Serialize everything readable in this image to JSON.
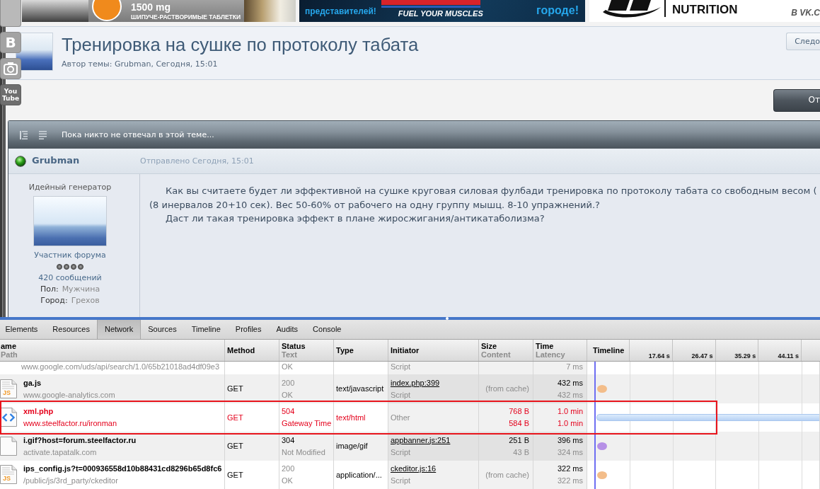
{
  "ad_banners": [
    {
      "kind": "tablets",
      "texts": [
        "1500 mg",
        "ШИПУЧЕ-РАСТВОРИМЫЕ ТАБЛЕТКИ"
      ]
    },
    {
      "kind": "protein",
      "texts": [
        "представителей!",
        "FUEL YOUR MUSCLES",
        "городе!"
      ]
    },
    {
      "kind": "nutrition",
      "texts": [
        "NUTRITION",
        "В VK.C"
      ]
    }
  ],
  "social_links": [
    {
      "kind": "tile"
    },
    {
      "kind": "letter",
      "label": "B"
    },
    {
      "kind": "camera"
    },
    {
      "kind": "wordmark",
      "label": "You Tube"
    }
  ],
  "topic": {
    "title": "Тренировка на сушке по протоколу табата",
    "meta": "Автор темы: Grubman, Сегодня, 15:01",
    "follow_button": "Следо"
  },
  "reply_button": "От",
  "thread": {
    "notice": "Пока никто не отвечал в этой теме...",
    "post": {
      "author": "Grubman",
      "online": true,
      "posted": "Отправлено Сегодня, 15:01",
      "user_title": "Идейный генератор",
      "group": "Участник форума",
      "stars": 4,
      "post_count": "420 сообщений",
      "fields": [
        {
          "label": "Пол:",
          "value": "Мужчина"
        },
        {
          "label": "Город:",
          "value": "Грехов"
        }
      ],
      "paragraphs": [
        [
          "Как вы считаете будет ли эффективной на сушке круговая силовая фулбади тренировка по протоколу табата со свободным весом (",
          "(8 инервалов 20+10 сек). Вес 50-60% от рабочего на одну группу мышц. 8-10 упражнений.?"
        ],
        [
          "Даст ли такая тренировка эффект в плане жиросжигания/антикатаболизма?"
        ]
      ]
    }
  },
  "devtools": {
    "tabs": [
      {
        "label": "Elements",
        "selected": false
      },
      {
        "label": "Resources",
        "selected": false
      },
      {
        "label": "Network",
        "selected": true
      },
      {
        "label": "Sources",
        "selected": false
      },
      {
        "label": "Timeline",
        "selected": false
      },
      {
        "label": "Profiles",
        "selected": false
      },
      {
        "label": "Audits",
        "selected": false
      },
      {
        "label": "Console",
        "selected": false
      }
    ],
    "columns": [
      {
        "kind": "text",
        "title": "ame",
        "subtitle": "Path"
      },
      {
        "kind": "text",
        "title": "Method"
      },
      {
        "kind": "text",
        "title": "Status",
        "subtitle": "Text"
      },
      {
        "kind": "text",
        "title": "Type"
      },
      {
        "kind": "text",
        "title": "Initiator"
      },
      {
        "kind": "text",
        "title": "Size",
        "subtitle": "Content"
      },
      {
        "kind": "text",
        "title": "Time",
        "subtitle": "Latency"
      },
      {
        "kind": "timeline",
        "title": "Timeline"
      }
    ],
    "timeline_ticks": [
      "17.64 s",
      "26.47 s",
      "35.29 s",
      "44.11 s"
    ],
    "rows": [
      {
        "kind": "partial",
        "path": "www.google.com/uds/api/search/1.0/65b21018ad4df09e3",
        "status_text": "OK",
        "initiator_type": "Script",
        "latency": "7 ms",
        "error": false,
        "outlined": false
      },
      {
        "kind": "full",
        "icon": {
          "kind": "js",
          "label": "JS"
        },
        "name": "ga.js",
        "path": "www.google-analytics.com",
        "method": "GET",
        "status": "200",
        "cached": true,
        "status_text": "OK",
        "type": "text/javascript",
        "initiator": {
          "kind": "link",
          "text": "index.php:399"
        },
        "initiator_type": "Script",
        "cache_note": "(from cache)",
        "time": "432 ms",
        "latency": "432 ms",
        "timeline": {
          "kind": "dot",
          "color": "#f3bd8a"
        },
        "error": false,
        "outlined": false
      },
      {
        "kind": "full",
        "icon": {
          "kind": "code"
        },
        "name": "xml.php",
        "path": "www.steelfactor.ru/ironman",
        "method": "GET",
        "status": "504",
        "cached": false,
        "status_text": "Gateway Time",
        "type": "text/html",
        "initiator": {
          "kind": "plain",
          "text": "Other"
        },
        "size": "768 B",
        "content": "584 B",
        "time": "1.0 min",
        "latency": "1.0 min",
        "timeline": {
          "kind": "bar"
        },
        "error": true,
        "outlined": true
      },
      {
        "kind": "full",
        "icon": {
          "kind": "blank"
        },
        "name": "i.gif?host=forum.steelfactor.ru",
        "path": "activate.tapatalk.com",
        "method": "GET",
        "status": "304",
        "cached": false,
        "status_text": "Not Modified",
        "type": "image/gif",
        "initiator": {
          "kind": "link",
          "text": "appbanner.js:251"
        },
        "initiator_type": "Script",
        "size": "251 B",
        "content": "43 B",
        "time": "396 ms",
        "latency": "324 ms",
        "timeline": {
          "kind": "dot",
          "color": "#b690e6"
        },
        "error": false,
        "outlined": false
      },
      {
        "kind": "full",
        "icon": {
          "kind": "js",
          "label": "JS"
        },
        "name": "ips_config.js?t=000936558d10b88431cd8296b65d8fc6",
        "path": "/public/js/3rd_party/ckeditor",
        "method": "GET",
        "status": "200",
        "cached": true,
        "status_text": "OK",
        "type": "application/...",
        "initiator": {
          "kind": "link",
          "text": "ckeditor.js:16"
        },
        "initiator_type": "Script",
        "cache_note": "(from cache)",
        "time": "322 ms",
        "latency": "322 ms",
        "timeline": {
          "kind": "dot",
          "color": "#f3bd8a"
        },
        "error": false,
        "outlined": false
      }
    ]
  }
}
